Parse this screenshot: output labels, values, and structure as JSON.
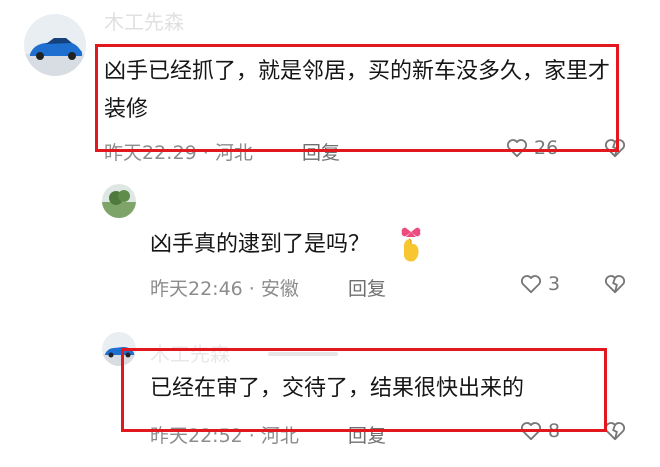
{
  "comments": [
    {
      "username": "木工先森",
      "text": "凶手已经抓了，就是邻居，买的新车没多久，家里才装修",
      "time": "昨天22:29",
      "location": "河北",
      "reply": "回复",
      "likes": "26"
    },
    {
      "username": "",
      "text": "凶手真的逮到了是吗？",
      "time": "昨天22:46",
      "location": "安徽",
      "reply": "回复",
      "likes": "3"
    },
    {
      "username": "木工先森",
      "text": "已经在审了，交待了，结果很快出来的",
      "time": "昨天22:52",
      "location": "河北",
      "reply": "回复",
      "likes": "8"
    }
  ],
  "colors": {
    "highlight": "#e2181e",
    "meta": "#8c8c8c"
  },
  "icons": [
    "avatar-car",
    "avatar-landscape",
    "heart-outline-icon",
    "dislike-heart-icon",
    "finger-heart-emoji"
  ]
}
